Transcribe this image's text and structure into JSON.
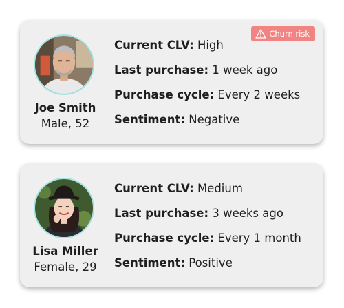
{
  "customers": [
    {
      "name": "Joe Smith",
      "demographics": "Male, 52",
      "avatar_icon": "man-portrait",
      "badge": {
        "label": "Churn risk",
        "icon": "warning-triangle-icon",
        "color": "#f28383"
      },
      "stats": [
        {
          "label": "Current CLV:",
          "value": "High"
        },
        {
          "label": "Last purchase:",
          "value": "1 week ago"
        },
        {
          "label": "Purchase cycle:",
          "value": "Every 2 weeks"
        },
        {
          "label": "Sentiment:",
          "value": "Negative"
        }
      ]
    },
    {
      "name": "Lisa Miller",
      "demographics": "Female, 29",
      "avatar_icon": "woman-portrait",
      "stats": [
        {
          "label": "Current CLV:",
          "value": "Medium"
        },
        {
          "label": "Last purchase:",
          "value": "3 weeks ago"
        },
        {
          "label": "Purchase cycle:",
          "value": "Every 1 month"
        },
        {
          "label": "Sentiment:",
          "value": "Positive"
        }
      ]
    }
  ],
  "colors": {
    "card_background": "#efefef",
    "avatar_ring": "#9fe3e3",
    "badge": "#f28383",
    "text": "#1e1e1e"
  }
}
